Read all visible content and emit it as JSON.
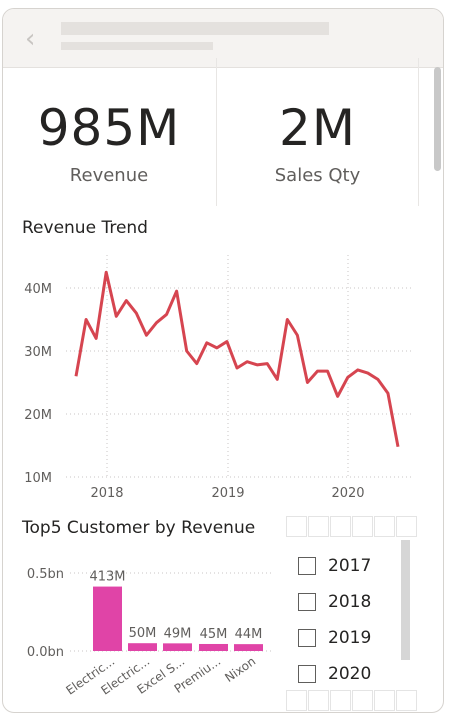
{
  "header": {
    "back_icon": "chevron-left-icon"
  },
  "kpis": [
    {
      "value": "985M",
      "label": "Revenue"
    },
    {
      "value": "2M",
      "label": "Sales Qty"
    }
  ],
  "trend": {
    "title": "Revenue Trend",
    "y_ticks": [
      "40M",
      "30M",
      "20M",
      "10M"
    ],
    "x_ticks": [
      "2018",
      "2019",
      "2020"
    ],
    "color": "#d64550"
  },
  "top5": {
    "title": "Top5 Customer by Revenue",
    "y_ticks": [
      "0.5bn",
      "0.0bn"
    ],
    "color": "#e044a7",
    "bars": [
      {
        "label": "Electric...",
        "value_label": "413M"
      },
      {
        "label": "Electric...",
        "value_label": "50M"
      },
      {
        "label": "Excel S...",
        "value_label": "49M"
      },
      {
        "label": "Premiu...",
        "value_label": "45M"
      },
      {
        "label": "Nixon",
        "value_label": "44M"
      }
    ]
  },
  "slicer": {
    "years": [
      "2017",
      "2018",
      "2019",
      "2020"
    ]
  },
  "chart_data": [
    {
      "type": "line",
      "title": "Revenue Trend",
      "xlabel": "",
      "ylabel": "",
      "ylim": [
        10,
        45
      ],
      "y_unit": "M",
      "x_ticks": [
        "2018",
        "2019",
        "2020"
      ],
      "values": [
        26,
        35,
        32,
        42.5,
        35.5,
        38,
        36,
        32.5,
        34.5,
        35.8,
        39.5,
        30,
        28,
        31.3,
        30.5,
        31.5,
        27.3,
        28.3,
        27.8,
        28,
        25.5,
        35,
        32.5,
        25,
        26.8,
        26.8,
        22.8,
        25.8,
        27,
        26.5,
        25.5,
        23.3,
        14.8
      ],
      "color": "#d64550"
    },
    {
      "type": "bar",
      "title": "Top5 Customer by Revenue",
      "categories": [
        "Electric...",
        "Electric...",
        "Excel S...",
        "Premiu...",
        "Nixon"
      ],
      "values": [
        413,
        50,
        49,
        45,
        44
      ],
      "value_unit": "M",
      "y_ticks": [
        "0.5bn",
        "0.0bn"
      ],
      "ylim": [
        0,
        500
      ],
      "color": "#e044a7"
    }
  ]
}
